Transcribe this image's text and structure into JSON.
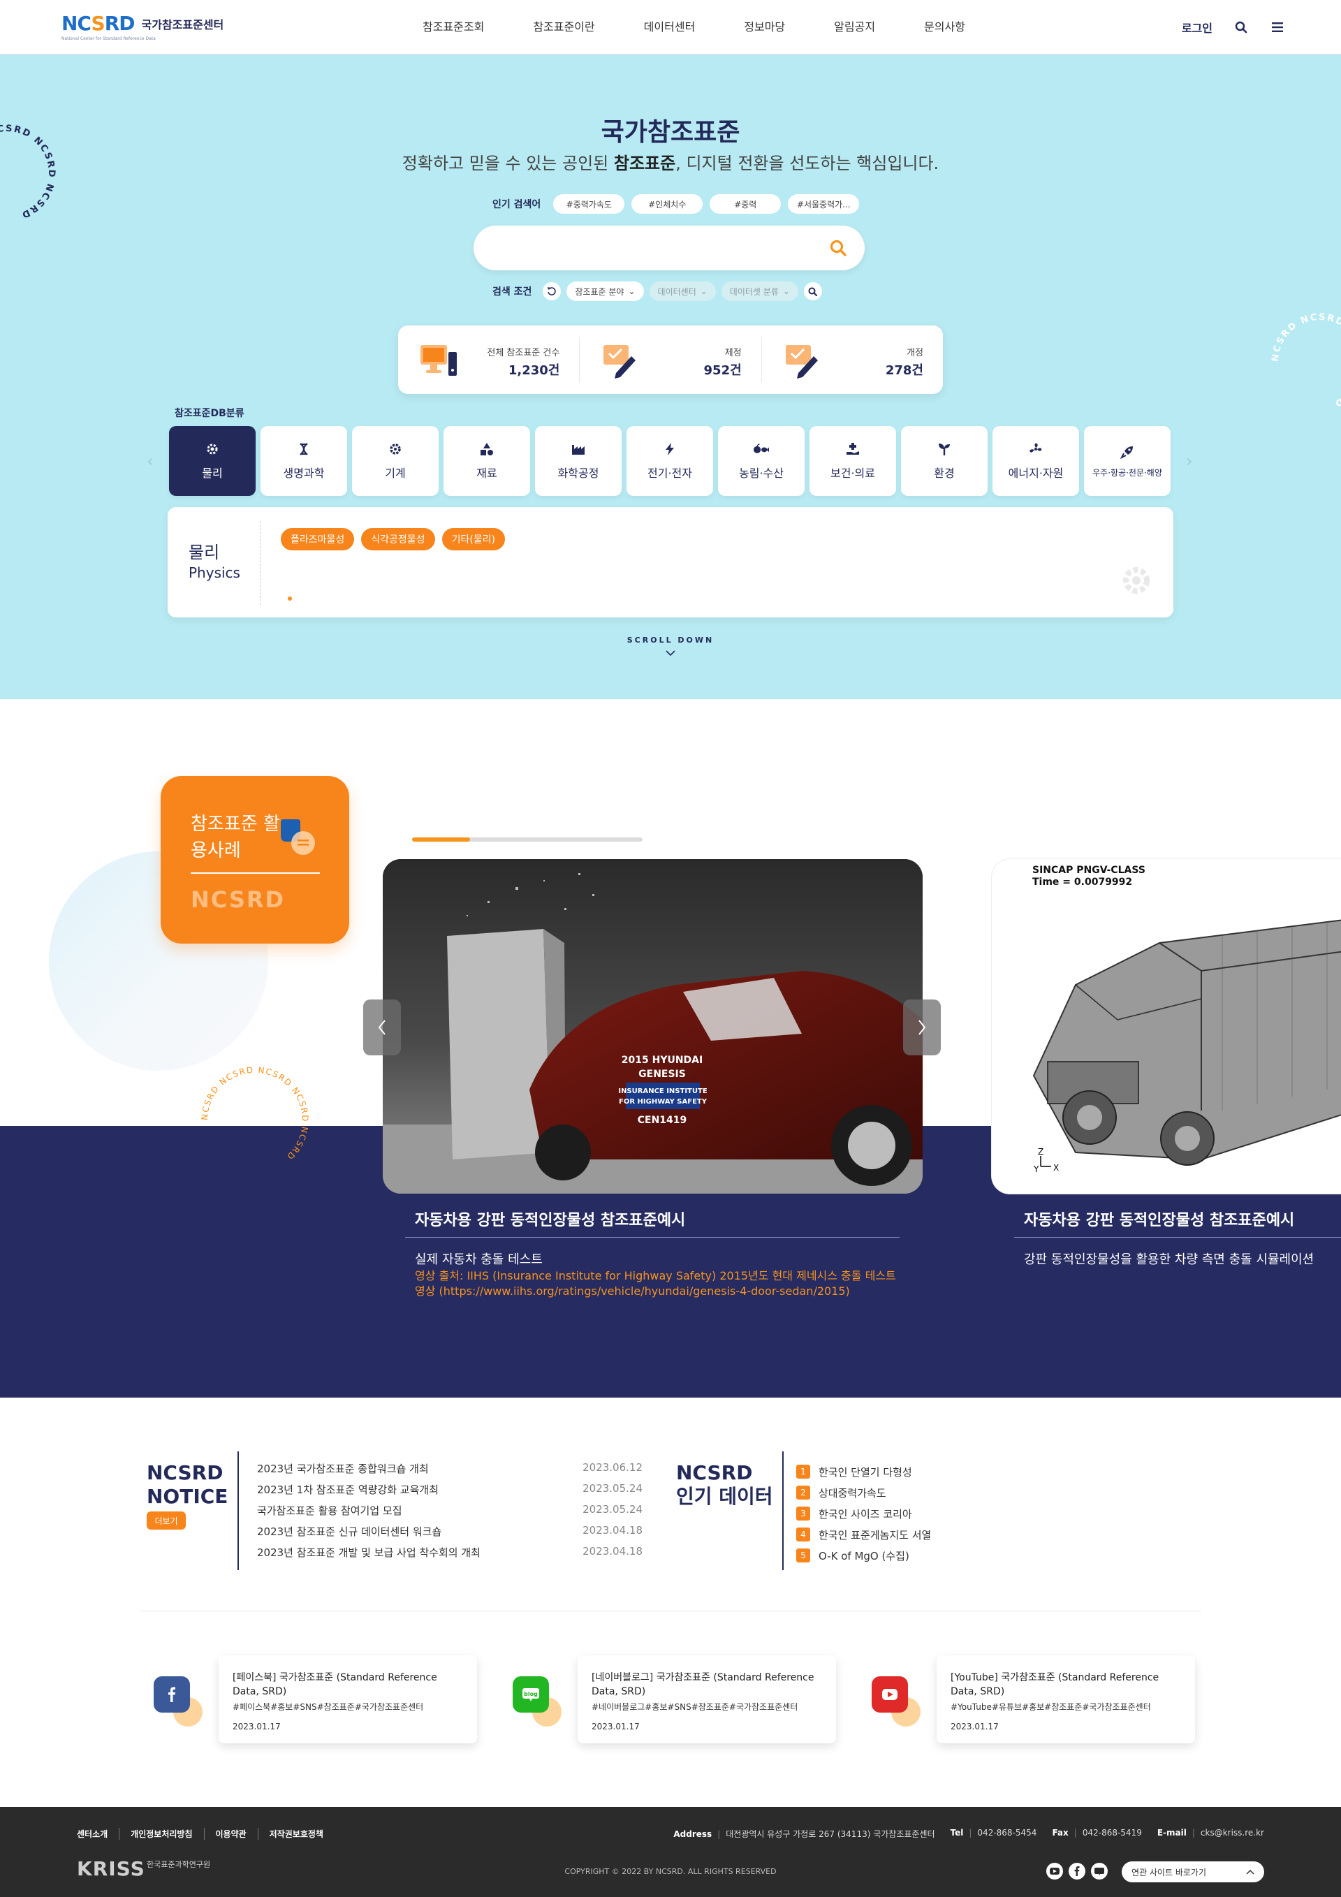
{
  "header": {
    "logo_mark_a": "NC",
    "logo_mark_o": "S",
    "logo_mark_b": "RD",
    "logo_sub": "National Center for Standard Reference Data",
    "logo_text": "국가참조표준센터",
    "nav": [
      "참조표준조회",
      "참조표준이란",
      "데이터센터",
      "정보마당",
      "알림공지",
      "문의사항"
    ],
    "login": "로그인"
  },
  "hero": {
    "title": "국가참조표준",
    "subtitle_pre": "정확하고 믿을 수 있는 공인된 ",
    "subtitle_bold": "참조표준",
    "subtitle_post": ", 디지털 전환을 선도하는 핵심입니다.",
    "popular_label": "인기 검색어",
    "popular_keywords": [
      "#중력가속도",
      "#인체치수",
      "#중력",
      "#서울중력가..."
    ],
    "search_placeholder": "",
    "condition_label": "검색 조건",
    "filters": [
      "참조표준 분야",
      "데이터센터",
      "데이터셋 분류"
    ],
    "ring_text": "NCSRD NCSRD NCSRD NCSRD"
  },
  "stats": [
    {
      "label": "전체 참조표준 건수",
      "value": "1,230건"
    },
    {
      "label": "제정",
      "value": "952건"
    },
    {
      "label": "개정",
      "value": "278건"
    }
  ],
  "db": {
    "label": "참조표준DB분류",
    "categories": [
      "물리",
      "생명과학",
      "기계",
      "재료",
      "화학공정",
      "전기·전자",
      "농림·수산",
      "보건·의료",
      "환경",
      "에너지·자원",
      "우주·항공·천문·해양"
    ],
    "active": "물리"
  },
  "detail": {
    "title_ko": "물리",
    "title_en": "Physics",
    "tags": [
      "플라즈마물성",
      "식각공정물성",
      "기타(물리)"
    ]
  },
  "scroll": "SCROLL DOWN",
  "cases": {
    "card_title": "참조표준 활용사례",
    "card_mark": "NCSRD",
    "progress": 0.25,
    "slide1": {
      "car_badge_1": "2015 HYUNDAI",
      "car_badge_2": "GENESIS",
      "car_badge_3": "INSURANCE INSTITUTE",
      "car_badge_4": "FOR HIGHWAY SAFETY",
      "car_badge_5": "CEN1419",
      "title": "자동차용 강판 동적인장물성 참조표준예시",
      "desc": "실제 자동차 충돌 테스트",
      "src1": "영상 출처: IIHS (Insurance Institute for Highway Safety) 2015년도 현대 제네시스 충돌 테스트",
      "src2": "영상 (https://www.iihs.org/ratings/vehicle/hyundai/genesis-4-door-sedan/2015)"
    },
    "slide2": {
      "sim_1": "SINCAP PNGV-CLASS",
      "sim_2": "Time =    0.0079992",
      "title": "자동차용 강판 동적인장물성 참조표준예시",
      "desc": "강판 동적인장물성을 활용한 차량 측면 충돌 시뮬레이션"
    },
    "ring_text": "NCSRD NCSRD NCSRD NCSRD NCSRD"
  },
  "notice": {
    "title_1": "NCSRD",
    "title_2": "NOTICE",
    "more": "더보기",
    "items": [
      {
        "title": "2023년 국가참조표준 종합워크숍 개최",
        "date": "2023.06.12"
      },
      {
        "title": "2023년 1차 참조표준 역량강화 교육개최",
        "date": "2023.05.24"
      },
      {
        "title": "국가참조표준 활용 참여기업 모집",
        "date": "2023.05.24"
      },
      {
        "title": "2023년 참조표준 신규 데이터센터 워크숍",
        "date": "2023.04.18"
      },
      {
        "title": "2023년 참조표준 개발 및 보급 사업 착수회의 개최",
        "date": "2023.04.18"
      }
    ]
  },
  "popular": {
    "title_1": "NCSRD",
    "title_2": "인기 데이터",
    "items": [
      {
        "rank": "1",
        "title": "한국인 단열기 다형성"
      },
      {
        "rank": "2",
        "title": "상대중력가속도"
      },
      {
        "rank": "3",
        "title": "한국인 사이즈 코리아"
      },
      {
        "rank": "4",
        "title": "한국인 표준게놈지도 서열"
      },
      {
        "rank": "5",
        "title": "O-K of MgO (수집)"
      }
    ]
  },
  "sns": [
    {
      "title": "[페이스북] 국가참조표준 (Standard Reference Data, SRD)",
      "hash": "#페이스북#홍보#SNS#참조표준#국가참조표준센터",
      "date": "2023.01.17",
      "color": "#3b5998"
    },
    {
      "title": "[네이버블로그] 국가참조표준 (Standard Reference Data, SRD)",
      "hash": "#네이버블로그#홍보#SNS#참조표준#국가참조표준센터",
      "date": "2023.01.17",
      "color": "#22b622"
    },
    {
      "title": "[YouTube] 국가참조표준 (Standard Reference Data, SRD)",
      "hash": "#YouTube#유튜브#홍보#참조표준#국가참조표준센터",
      "date": "2023.01.17",
      "color": "#e02a2a"
    }
  ],
  "footer": {
    "links": [
      "센터소개",
      "개인정보처리방침",
      "이용약관",
      "저작권보호정책"
    ],
    "address_label": "Address",
    "address": "대전광역시 유성구 가정로 267 (34113) 국가참조표준센터",
    "tel_label": "Tel",
    "tel": "042-868-5454",
    "fax_label": "Fax",
    "fax": "042-868-5419",
    "email_label": "E-mail",
    "email": "cks@kriss.re.kr",
    "kriss": "KRISS",
    "kriss_sub": "한국표준과학연구원",
    "copyright": "COPYRIGHT © 2022 BY NCSRD. ALL RIGHTS RESERVED",
    "related": "연관 사이트 바로가기"
  }
}
